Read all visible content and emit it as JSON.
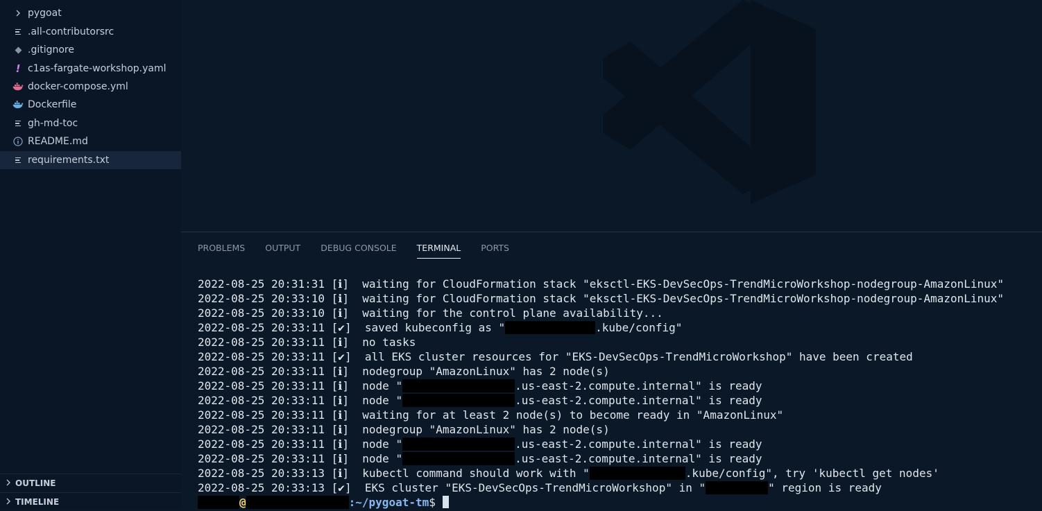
{
  "explorer": {
    "items": [
      {
        "label": "pygoat",
        "icon": "chevron-right-icon"
      },
      {
        "label": ".all-contributorsrc",
        "icon": "lines-file-icon"
      },
      {
        "label": ".gitignore",
        "icon": "git-icon"
      },
      {
        "label": "c1as-fargate-workshop.yaml",
        "icon": "exclamation-icon"
      },
      {
        "label": "docker-compose.yml",
        "icon": "docker-icon"
      },
      {
        "label": "Dockerfile",
        "icon": "docker-icon"
      },
      {
        "label": "gh-md-toc",
        "icon": "lines-file-icon"
      },
      {
        "label": "README.md",
        "icon": "info-icon"
      },
      {
        "label": "requirements.txt",
        "icon": "lines-file-icon"
      }
    ],
    "selected_index": 8
  },
  "sections": {
    "outline": "OUTLINE",
    "timeline": "TIMELINE"
  },
  "panel": {
    "tabs": [
      "PROBLEMS",
      "OUTPUT",
      "DEBUG CONSOLE",
      "TERMINAL",
      "PORTS"
    ],
    "active_tab": "TERMINAL"
  },
  "terminal": {
    "lines": [
      {
        "ts": "2022-08-25 20:31:31",
        "tag": "[ℹ]",
        "text": "waiting for CloudFormation stack \"eksctl-EKS-DevSecOps-TrendMicroWorkshop-nodegroup-AmazonLinux\""
      },
      {
        "ts": "2022-08-25 20:33:10",
        "tag": "[ℹ]",
        "text": "waiting for CloudFormation stack \"eksctl-EKS-DevSecOps-TrendMicroWorkshop-nodegroup-AmazonLinux\""
      },
      {
        "ts": "2022-08-25 20:33:10",
        "tag": "[ℹ]",
        "text": "waiting for the control plane availability..."
      },
      {
        "ts": "2022-08-25 20:33:11",
        "tag": "[✔]",
        "pre": "saved kubeconfig as \"",
        "post": ".kube/config\""
      },
      {
        "ts": "2022-08-25 20:33:11",
        "tag": "[ℹ]",
        "text": "no tasks"
      },
      {
        "ts": "2022-08-25 20:33:11",
        "tag": "[✔]",
        "text": "all EKS cluster resources for \"EKS-DevSecOps-TrendMicroWorkshop\" have been created"
      },
      {
        "ts": "2022-08-25 20:33:11",
        "tag": "[ℹ]",
        "text": "nodegroup \"AmazonLinux\" has 2 node(s)"
      },
      {
        "ts": "2022-08-25 20:33:11",
        "tag": "[ℹ]",
        "pre": "node \"",
        "post": ".us-east-2.compute.internal\" is ready"
      },
      {
        "ts": "2022-08-25 20:33:11",
        "tag": "[ℹ]",
        "pre": "node \"",
        "post": ".us-east-2.compute.internal\" is ready"
      },
      {
        "ts": "2022-08-25 20:33:11",
        "tag": "[ℹ]",
        "text": "waiting for at least 2 node(s) to become ready in \"AmazonLinux\""
      },
      {
        "ts": "2022-08-25 20:33:11",
        "tag": "[ℹ]",
        "text": "nodegroup \"AmazonLinux\" has 2 node(s)"
      },
      {
        "ts": "2022-08-25 20:33:11",
        "tag": "[ℹ]",
        "pre": "node \"",
        "post": ".us-east-2.compute.internal\" is ready"
      },
      {
        "ts": "2022-08-25 20:33:11",
        "tag": "[ℹ]",
        "pre": "node \"",
        "post": ".us-east-2.compute.internal\" is ready"
      },
      {
        "ts": "2022-08-25 20:33:13",
        "tag": "[ℹ]",
        "pre": "kubectl command should work with \"",
        "post": ".kube/config\", try 'kubectl get nodes'"
      },
      {
        "ts": "2022-08-25 20:33:13",
        "tag": "[✔]",
        "pre": "EKS cluster \"EKS-DevSecOps-TrendMicroWorkshop\" in \"",
        "post": "\" region is ready"
      }
    ],
    "prompt": {
      "at": "@",
      "path": ":~/pygoat-tm",
      "symbol": "$"
    }
  },
  "colors": {
    "background": "#0b1828",
    "sidebar": "#0a1526",
    "selected_row": "#17263a",
    "docker": "#e26f8f",
    "dockerfile": "#6ab0de",
    "exclamation": "#c586e8",
    "prompt_path": "#88b7ee"
  }
}
